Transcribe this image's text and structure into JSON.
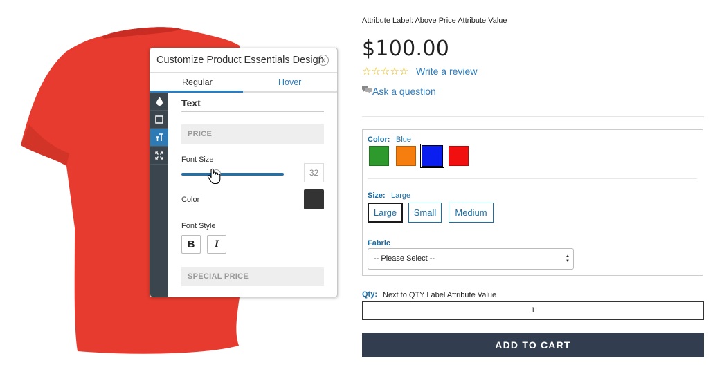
{
  "product_image": {
    "color": "#e63b2e"
  },
  "customizer": {
    "title": "Customize Product Essentials Design",
    "close_symbol": "×",
    "tabs": [
      {
        "label": "Regular",
        "active": true
      },
      {
        "label": "Hover",
        "active": false
      }
    ],
    "sidebar_icons": [
      "drop-icon",
      "square-icon",
      "text-size-icon",
      "expand-icon"
    ],
    "section_title": "Text",
    "price_field": "PRICE",
    "font_size_label": "Font Size",
    "font_size_value": "32",
    "font_size_slider_fraction": 0.32,
    "color_label": "Color",
    "color_value": "#333333",
    "font_style_label": "Font Style",
    "bold_label": "B",
    "italic_label": "I",
    "special_price_field": "SPECIAL PRICE"
  },
  "product": {
    "attribute_label_top": "Attribute Label:  Above Price Attribute Value",
    "price": "$100.00",
    "rating_stars": "☆☆☆☆☆",
    "write_review": "Write a review",
    "ask_question": "Ask a question",
    "color_label": "Color:",
    "color_value": "Blue",
    "colors": [
      {
        "name": "green",
        "hex": "#2e9a2e",
        "selected": false
      },
      {
        "name": "orange",
        "hex": "#f57e0f",
        "selected": false
      },
      {
        "name": "blue",
        "hex": "#0a1ef0",
        "selected": true
      },
      {
        "name": "red",
        "hex": "#f20f0f",
        "selected": false
      }
    ],
    "size_label": "Size:",
    "size_value": "Large",
    "sizes": [
      {
        "label": "Large",
        "selected": true
      },
      {
        "label": "Small",
        "selected": false
      },
      {
        "label": "Medium",
        "selected": false
      }
    ],
    "fabric_label": "Fabric",
    "fabric_select": "-- Please Select --",
    "qty_label": "Qty:",
    "qty_note": "Next to QTY Label Attribute Value",
    "qty_value": "1",
    "add_to_cart": "ADD TO CART"
  }
}
